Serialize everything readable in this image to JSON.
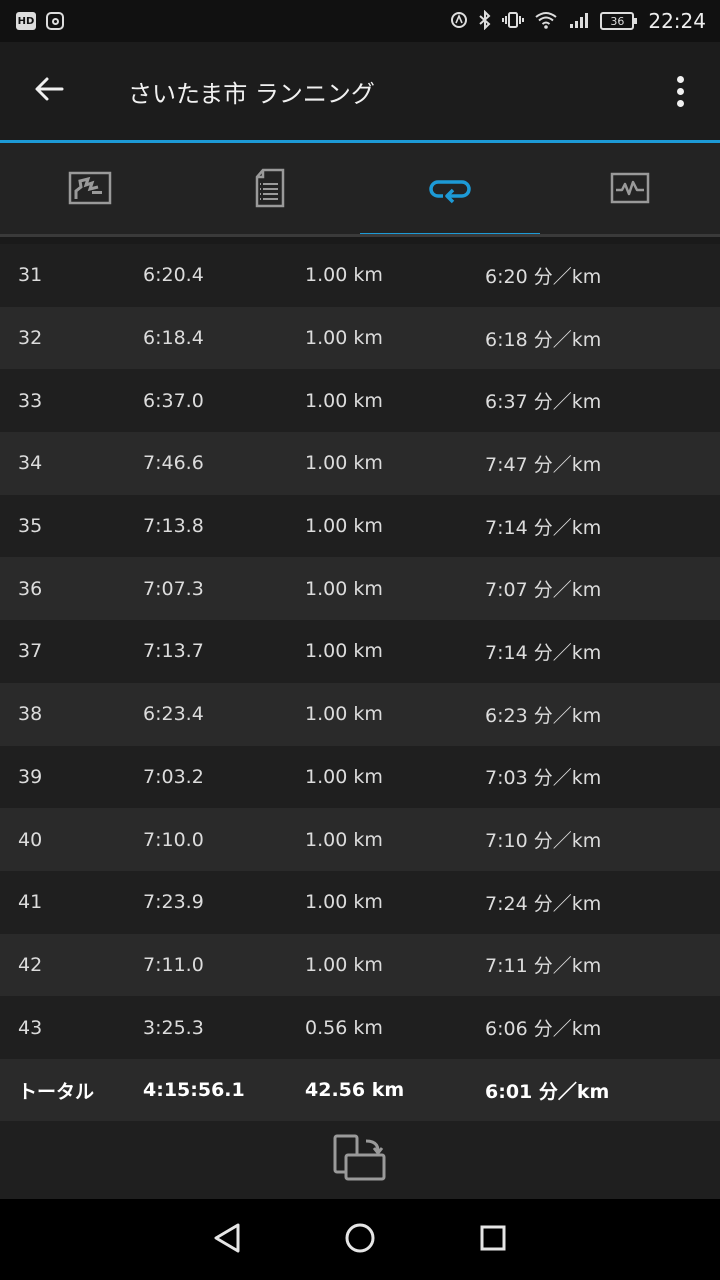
{
  "status_bar": {
    "left_icons": [
      "hd-icon",
      "instagram-icon"
    ],
    "hd_label": "HD",
    "battery": "36",
    "time": "22:24"
  },
  "app_bar": {
    "title": "さいたま市 ランニング",
    "back_icon": "arrow-left-icon",
    "menu_icon": "more-vert-icon"
  },
  "tabs": [
    {
      "icon": "map-icon",
      "active": false
    },
    {
      "icon": "details-icon",
      "active": false
    },
    {
      "icon": "laps-icon",
      "active": true
    },
    {
      "icon": "chart-icon",
      "active": false
    }
  ],
  "accent_color": "#1d9ad6",
  "laps": [
    {
      "lap": "31",
      "time": "6:20.4",
      "distance": "1.00 km",
      "pace": "6:20 分／km"
    },
    {
      "lap": "32",
      "time": "6:18.4",
      "distance": "1.00 km",
      "pace": "6:18 分／km"
    },
    {
      "lap": "33",
      "time": "6:37.0",
      "distance": "1.00 km",
      "pace": "6:37 分／km"
    },
    {
      "lap": "34",
      "time": "7:46.6",
      "distance": "1.00 km",
      "pace": "7:47 分／km"
    },
    {
      "lap": "35",
      "time": "7:13.8",
      "distance": "1.00 km",
      "pace": "7:14 分／km"
    },
    {
      "lap": "36",
      "time": "7:07.3",
      "distance": "1.00 km",
      "pace": "7:07 分／km"
    },
    {
      "lap": "37",
      "time": "7:13.7",
      "distance": "1.00 km",
      "pace": "7:14 分／km"
    },
    {
      "lap": "38",
      "time": "6:23.4",
      "distance": "1.00 km",
      "pace": "6:23 分／km"
    },
    {
      "lap": "39",
      "time": "7:03.2",
      "distance": "1.00 km",
      "pace": "7:03 分／km"
    },
    {
      "lap": "40",
      "time": "7:10.0",
      "distance": "1.00 km",
      "pace": "7:10 分／km"
    },
    {
      "lap": "41",
      "time": "7:23.9",
      "distance": "1.00 km",
      "pace": "7:24 分／km"
    },
    {
      "lap": "42",
      "time": "7:11.0",
      "distance": "1.00 km",
      "pace": "7:11 分／km"
    },
    {
      "lap": "43",
      "time": "3:25.3",
      "distance": "0.56 km",
      "pace": "6:06 分／km"
    }
  ],
  "total": {
    "label": "トータル",
    "time": "4:15:56.1",
    "distance": "42.56 km",
    "pace": "6:01 分／km"
  },
  "bottom_action_icon": "rotate-screen-icon",
  "nav_bar": [
    "back-triangle-icon",
    "home-circle-icon",
    "recents-square-icon"
  ]
}
